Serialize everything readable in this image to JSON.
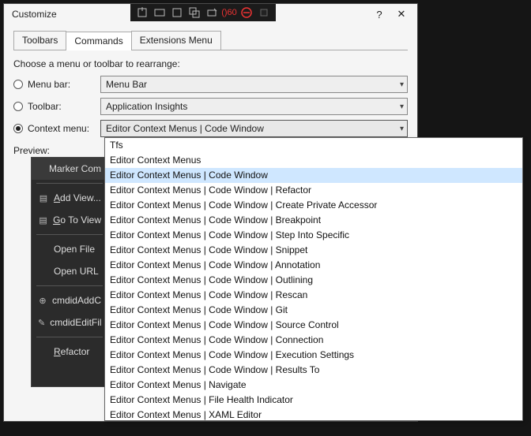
{
  "title": "Customize",
  "help_glyph": "?",
  "close_glyph": "✕",
  "toolbar_badge": "60",
  "tabs": {
    "toolbars": "Toolbars",
    "commands": "Commands",
    "extensions": "Extensions Menu"
  },
  "instruction": "Choose a menu or toolbar to rearrange:",
  "radios": {
    "menubar": {
      "label": "Menu bar:",
      "value": "Menu Bar"
    },
    "toolbar": {
      "label": "Toolbar:",
      "value": "Application Insights"
    },
    "context": {
      "label": "Context menu:",
      "value": "Editor Context Menus | Code Window"
    }
  },
  "preview_label": "Preview:",
  "preview_items": [
    {
      "label": "Marker Com",
      "head": true
    },
    {
      "label": "Add View...",
      "icon": "doc",
      "underline": "A"
    },
    {
      "label": "Go To View",
      "icon": "doc",
      "underline": "G"
    },
    {
      "label": "Open File"
    },
    {
      "label": "Open URL"
    },
    {
      "label": "cmdidAddC",
      "icon": "plus"
    },
    {
      "label": "cmdidEditFil",
      "icon": "edit"
    },
    {
      "label": "Refactor",
      "underline": "R"
    }
  ],
  "dropdown_selected_index": 2,
  "dropdown_items": [
    "Tfs",
    "Editor Context Menus",
    "Editor Context Menus | Code Window",
    "Editor Context Menus | Code Window | Refactor",
    "Editor Context Menus | Code Window | Create Private Accessor",
    "Editor Context Menus | Code Window | Breakpoint",
    "Editor Context Menus | Code Window | Step Into Specific",
    "Editor Context Menus | Code Window | Snippet",
    "Editor Context Menus | Code Window | Annotation",
    "Editor Context Menus | Code Window | Outlining",
    "Editor Context Menus | Code Window | Rescan",
    "Editor Context Menus | Code Window | Git",
    "Editor Context Menus | Code Window | Source Control",
    "Editor Context Menus | Code Window | Connection",
    "Editor Context Menus | Code Window | Execution Settings",
    "Editor Context Menus | Code Window | Results To",
    "Editor Context Menus | Navigate",
    "Editor Context Menus | File Health Indicator",
    "Editor Context Menus | XAML Editor"
  ]
}
